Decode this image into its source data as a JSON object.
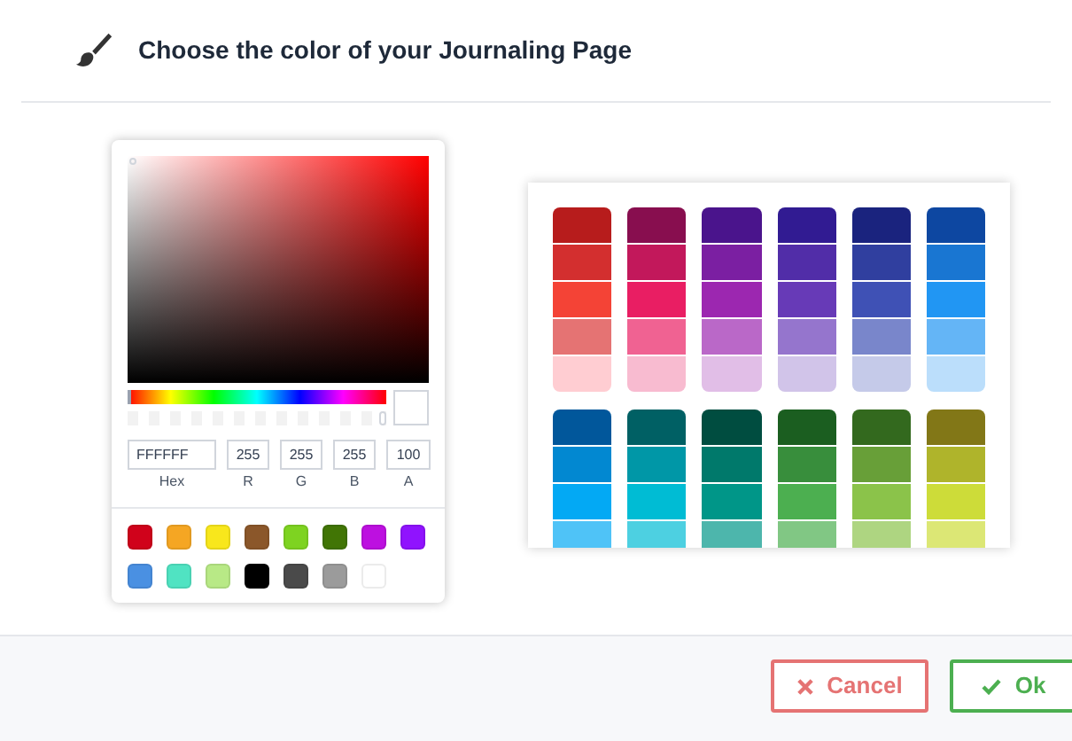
{
  "header": {
    "title": "Choose the color of your Journaling Page"
  },
  "picker": {
    "hue_slider": {
      "level": 0
    },
    "alpha_slider": {
      "level": 1
    },
    "fields": [
      {
        "label": "Hex",
        "value": "FFFFFF"
      },
      {
        "label": "R",
        "value": "255"
      },
      {
        "label": "G",
        "value": "255"
      },
      {
        "label": "B",
        "value": "255"
      },
      {
        "label": "A",
        "value": "100"
      }
    ],
    "presets": [
      [
        {
          "color": "#d0021b"
        },
        {
          "color": "#f5a623"
        },
        {
          "color": "#f8e71c"
        },
        {
          "color": "#8b572a"
        },
        {
          "color": "#7ed321"
        },
        {
          "color": "#417505"
        },
        {
          "color": "#bd10e0"
        },
        {
          "color": "#9013fe"
        }
      ],
      [
        {
          "color": "#4a90e2"
        },
        {
          "color": "#50e3c2"
        },
        {
          "color": "#b8e986"
        },
        {
          "color": "#000000"
        },
        {
          "color": "#4a4a4a"
        },
        {
          "color": "#9b9b9b"
        },
        {
          "color": "#ffffff"
        }
      ]
    ]
  },
  "palette": {
    "groups": [
      {
        "columns": [
          [
            {
              "color": "#b71c1c"
            },
            {
              "color": "#d32f2f"
            },
            {
              "color": "#f44336"
            },
            {
              "color": "#e57373"
            },
            {
              "color": "#ffcdd2"
            }
          ],
          [
            {
              "color": "#880e4f"
            },
            {
              "color": "#c2185b"
            },
            {
              "color": "#e91e63"
            },
            {
              "color": "#f06292"
            },
            {
              "color": "#f8bbd0"
            }
          ],
          [
            {
              "color": "#4a148c"
            },
            {
              "color": "#7b1fa2"
            },
            {
              "color": "#9c27b0"
            },
            {
              "color": "#ba68c8"
            },
            {
              "color": "#e1bee7"
            }
          ],
          [
            {
              "color": "#311b92"
            },
            {
              "color": "#512da8"
            },
            {
              "color": "#673ab7"
            },
            {
              "color": "#9575cd"
            },
            {
              "color": "#d1c4e9"
            }
          ],
          [
            {
              "color": "#1a237e"
            },
            {
              "color": "#303f9f"
            },
            {
              "color": "#3f51b5"
            },
            {
              "color": "#7986cb"
            },
            {
              "color": "#c5cae9"
            }
          ],
          [
            {
              "color": "#0d47a1"
            },
            {
              "color": "#1976d2"
            },
            {
              "color": "#2196f3"
            },
            {
              "color": "#64b5f6"
            },
            {
              "color": "#bbdefb"
            }
          ]
        ]
      },
      {
        "columns": [
          [
            {
              "color": "#01579b"
            },
            {
              "color": "#0288d1"
            },
            {
              "color": "#03a9f4"
            },
            {
              "color": "#4fc3f7"
            }
          ],
          [
            {
              "color": "#006064"
            },
            {
              "color": "#0097a7"
            },
            {
              "color": "#00bcd4"
            },
            {
              "color": "#4dd0e1"
            }
          ],
          [
            {
              "color": "#004d40"
            },
            {
              "color": "#00796b"
            },
            {
              "color": "#009688"
            },
            {
              "color": "#4db6ac"
            }
          ],
          [
            {
              "color": "#1b5e20"
            },
            {
              "color": "#388e3c"
            },
            {
              "color": "#4caf50"
            },
            {
              "color": "#81c784"
            }
          ],
          [
            {
              "color": "#33691e"
            },
            {
              "color": "#689f38"
            },
            {
              "color": "#8bc34a"
            },
            {
              "color": "#aed581"
            }
          ],
          [
            {
              "color": "#827717"
            },
            {
              "color": "#afb42b"
            },
            {
              "color": "#cddc39"
            },
            {
              "color": "#dce775"
            }
          ]
        ]
      }
    ]
  },
  "buttons": [
    {
      "kind": "cancel",
      "label": "Cancel"
    },
    {
      "kind": "ok",
      "label": "Ok"
    }
  ]
}
